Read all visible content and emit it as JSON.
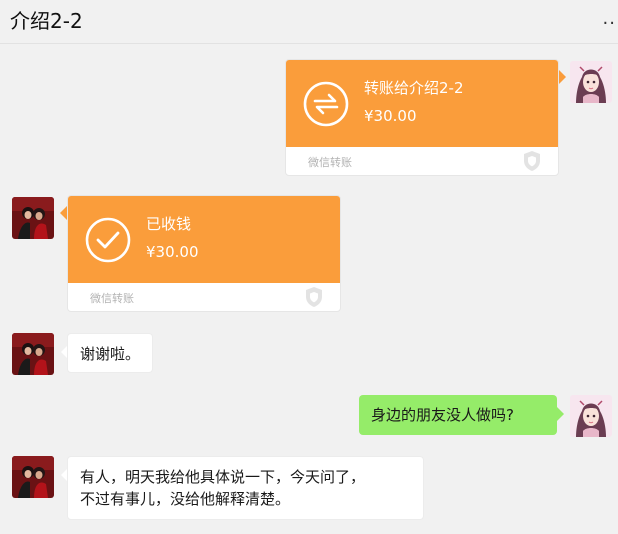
{
  "header": {
    "title": "介绍2-2",
    "more": ".."
  },
  "messages": {
    "m1": {
      "title": "转账给介绍2-2",
      "amount": "¥30.00",
      "footer": "微信转账"
    },
    "m2": {
      "title": "已收钱",
      "amount": "¥30.00",
      "footer": "微信转账"
    },
    "m3": {
      "text": "谢谢啦。"
    },
    "m4": {
      "text": "身边的朋友没人做吗?"
    },
    "m5": {
      "line1": "有人，明天我给他具体说一下，今天问了，",
      "line2": "不过有事儿，没给他解释清楚。"
    }
  },
  "colors": {
    "transfer_orange": "#fa9d3b",
    "sent_green": "#95ec69",
    "background": "#f1f1f1"
  }
}
